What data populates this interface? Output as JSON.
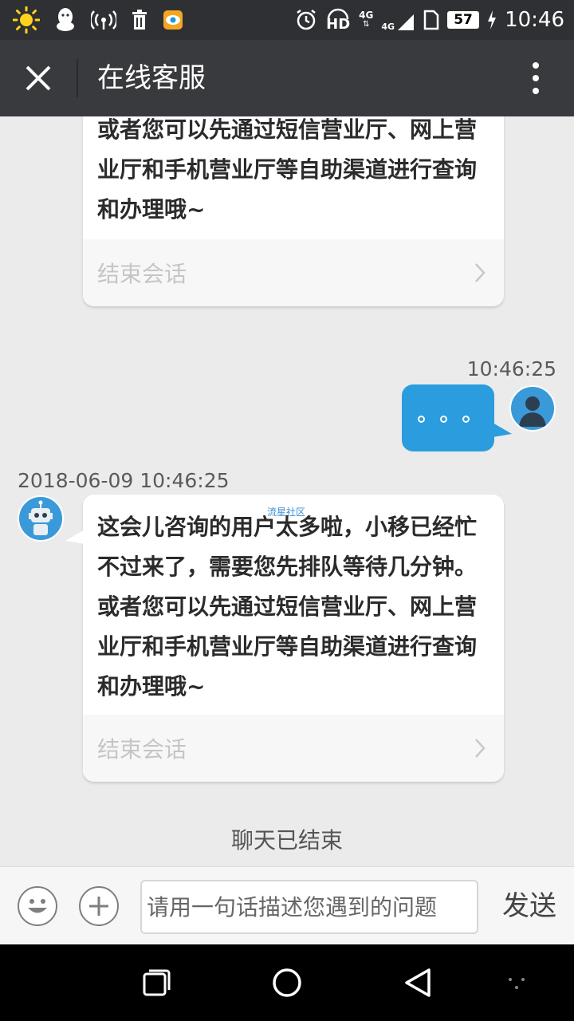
{
  "status_bar": {
    "time": "10:46",
    "battery": "57",
    "icons": [
      "sun-icon",
      "qq-icon",
      "hotspot-icon",
      "trash-icon",
      "app-icon",
      "alarm-icon",
      "hd-icon",
      "4g-icon",
      "signal-icon",
      "sim-icon",
      "charging-icon"
    ],
    "hd_label": "HD",
    "net_label": "4G",
    "net_label2": "4G"
  },
  "header": {
    "title": "在线客服"
  },
  "chat": {
    "messages": [
      {
        "sender": "agent",
        "text": "或者您可以先通过短信营业厅、网上营业厅和手机营业厅等自助渠道进行查询和办理哦~",
        "action": "结束会话"
      },
      {
        "sender": "user",
        "timestamp": "10:46:25",
        "text": "。。。"
      },
      {
        "sender": "agent",
        "timestamp": "2018-06-09 10:46:25",
        "watermark": "流星社区",
        "text": "这会儿咨询的用户太多啦，小移已经忙不过来了，需要您先排队等待几分钟。或者您可以先通过短信营业厅、网上营业厅和手机营业厅等自助渠道进行查询和办理哦~",
        "action": "结束会话"
      }
    ],
    "ended_notice": "聊天已结束"
  },
  "input_bar": {
    "placeholder": "请用一句话描述您遇到的问题",
    "send_label": "发送"
  },
  "colors": {
    "status_bar": "#2f3033",
    "title_bar": "#393a3e",
    "chat_bg": "#ebebeb",
    "user_bubble": "#2b9cde"
  }
}
